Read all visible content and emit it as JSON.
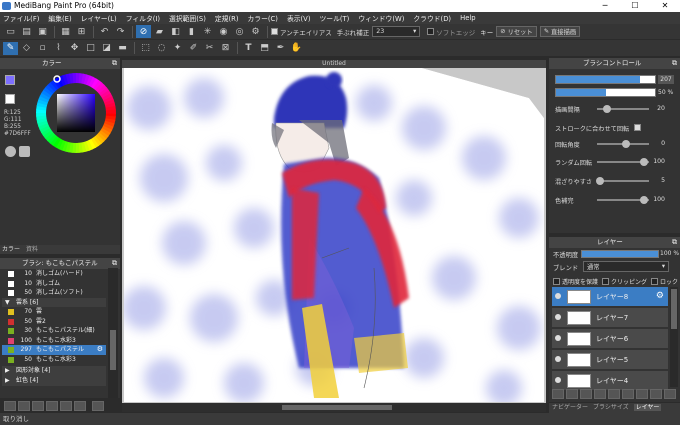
{
  "window": {
    "title": "MediBang Paint Pro (64bit)"
  },
  "menu": [
    "ファイル(F)",
    "編集(E)",
    "レイヤー(L)",
    "フィルタ(I)",
    "選択範囲(S)",
    "定規(R)",
    "カラー(C)",
    "表示(V)",
    "ツール(T)",
    "ウィンドウ(W)",
    "クラウド(D)",
    "Help"
  ],
  "toolbar": {
    "antialias_label": "アンチエイリアス",
    "correction_label": "手ぶれ補正",
    "correction_value": "23",
    "soft_edge_label": "ソフトエッジ",
    "key_label": "キー",
    "reset_label": "リセット",
    "direct_draw_label": "直接描画"
  },
  "color_panel": {
    "title": "カラー",
    "r": "R:125",
    "g": "G:111",
    "b": "B:255",
    "hex": "#7D6FFF",
    "fg_color": "#7d6fff",
    "tabs": [
      "カラー",
      "資料"
    ]
  },
  "brush_panel": {
    "title": "ブラシ: もこもこパステル",
    "items": [
      {
        "num": "10",
        "name": "消しゴム(ハード)",
        "color": "#ffffff"
      },
      {
        "num": "10",
        "name": "消しゴム",
        "color": "#ffffff"
      },
      {
        "num": "50",
        "name": "消しゴム(ソフト)",
        "color": "#ffffff"
      }
    ],
    "group_open": "雲系 [6]",
    "group_items": [
      {
        "num": "70",
        "name": "雲",
        "color": "#e0c020"
      },
      {
        "num": "50",
        "name": "雲2",
        "color": "#d03030"
      },
      {
        "num": "30",
        "name": "もこもこパステル(細)",
        "color": "#7ab020"
      },
      {
        "num": "100",
        "name": "もこもこ水彩3",
        "color": "#e04070"
      },
      {
        "num": "297",
        "name": "もこもこパステル",
        "color": "#7ab020",
        "selected": true
      },
      {
        "num": "50",
        "name": "もこもこ水彩3",
        "color": "#7ab020"
      }
    ],
    "collapsed_groups": [
      "図形対象 [4]",
      "虹色 [4]"
    ]
  },
  "canvas": {
    "tab": "Untitled"
  },
  "brush_control": {
    "title": "ブラシコントロール",
    "size_value": "207",
    "opacity_value": "50 %",
    "size_fill": 0.85,
    "opacity_fill": 0.5,
    "rows": [
      {
        "label": "描画間隔",
        "value": "20",
        "pos": 0.2
      },
      {
        "label": "回転角度",
        "value": "0",
        "pos": 0.55
      },
      {
        "label": "ランダム回転",
        "value": "100",
        "pos": 0.9
      },
      {
        "label": "混ざりやすさ",
        "value": "5",
        "pos": 0.05
      },
      {
        "label": "色補完",
        "value": "100",
        "pos": 0.9
      }
    ],
    "stroke_check_label": "ストロークに合わせて回転"
  },
  "layer_panel": {
    "title": "レイヤー",
    "opacity_label": "不透明度",
    "opacity_value": "100 %",
    "blend_label": "ブレンド",
    "blend_value": "通常",
    "protect_label": "透明度を保護",
    "clip_label": "クリッピング",
    "lock_label": "ロック",
    "layers": [
      {
        "name": "レイヤー8",
        "selected": true
      },
      {
        "name": "レイヤー7"
      },
      {
        "name": "レイヤー6"
      },
      {
        "name": "レイヤー5"
      },
      {
        "name": "レイヤー4"
      }
    ]
  },
  "bottom_tabs": [
    "ナビゲーター",
    "ブラシサイズ",
    "レイヤー"
  ],
  "status": {
    "text": "取り消し"
  }
}
